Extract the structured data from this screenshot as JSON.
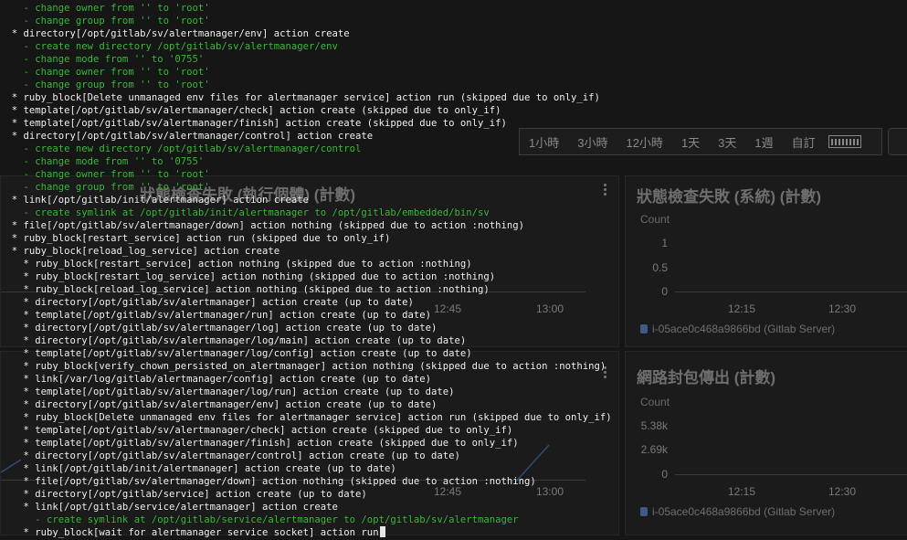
{
  "dashboard": {
    "time_range": {
      "options": [
        "1小時",
        "3小時",
        "12小時",
        "1天",
        "3天",
        "1週",
        "自訂"
      ]
    },
    "panels": [
      {
        "title": "狀態檢查失敗 (執行個體) (計數)",
        "x_ticks": [
          "12:45",
          "13:00"
        ]
      },
      {
        "title": "狀態檢查失敗 (系統) (計數)",
        "unit": "Count",
        "y_ticks": [
          "1",
          "0.5",
          "0"
        ],
        "x_ticks": [
          "12:15",
          "12:30"
        ],
        "legend": "i-05ace0c468a9866bd (Gitlab Server)",
        "legend_color": "#3d5a86"
      },
      {
        "title": "",
        "x_ticks": [
          "12:45",
          "13:00"
        ]
      },
      {
        "title": "網路封包傳出 (計數)",
        "unit": "Count",
        "y_ticks": [
          "5.38k",
          "2.69k",
          "0"
        ],
        "x_ticks": [
          "12:15",
          "12:30"
        ],
        "legend": "i-05ace0c468a9866bd (Gitlab Server)",
        "legend_color": "#3d5a86"
      }
    ]
  },
  "terminal": {
    "colors": {
      "white": "#f4f4f4",
      "green": "#3bbf3b"
    },
    "lines": [
      {
        "c": "green",
        "t": "    - change owner from '' to 'root'"
      },
      {
        "c": "green",
        "t": "    - change group from '' to 'root'"
      },
      {
        "c": "white",
        "t": "  * directory[/opt/gitlab/sv/alertmanager/env] action create"
      },
      {
        "c": "green",
        "t": "    - create new directory /opt/gitlab/sv/alertmanager/env"
      },
      {
        "c": "green",
        "t": "    - change mode from '' to '0755'"
      },
      {
        "c": "green",
        "t": "    - change owner from '' to 'root'"
      },
      {
        "c": "green",
        "t": "    - change group from '' to 'root'"
      },
      {
        "c": "white",
        "t": "  * ruby_block[Delete unmanaged env files for alertmanager service] action run (skipped due to only_if)"
      },
      {
        "c": "white",
        "t": "  * template[/opt/gitlab/sv/alertmanager/check] action create (skipped due to only_if)"
      },
      {
        "c": "white",
        "t": "  * template[/opt/gitlab/sv/alertmanager/finish] action create (skipped due to only_if)"
      },
      {
        "c": "white",
        "t": "  * directory[/opt/gitlab/sv/alertmanager/control] action create"
      },
      {
        "c": "green",
        "t": "    - create new directory /opt/gitlab/sv/alertmanager/control"
      },
      {
        "c": "green",
        "t": "    - change mode from '' to '0755'"
      },
      {
        "c": "green",
        "t": "    - change owner from '' to 'root'"
      },
      {
        "c": "green",
        "t": "    - change group from '' to 'root'"
      },
      {
        "c": "white",
        "t": "  * link[/opt/gitlab/init/alertmanager] action create"
      },
      {
        "c": "green",
        "t": "    - create symlink at /opt/gitlab/init/alertmanager to /opt/gitlab/embedded/bin/sv"
      },
      {
        "c": "white",
        "t": "  * file[/opt/gitlab/sv/alertmanager/down] action nothing (skipped due to action :nothing)"
      },
      {
        "c": "white",
        "t": "  * ruby_block[restart_service] action run (skipped due to only_if)"
      },
      {
        "c": "white",
        "t": "  * ruby_block[reload_log_service] action create"
      },
      {
        "c": "white",
        "t": "    * ruby_block[restart_service] action nothing (skipped due to action :nothing)"
      },
      {
        "c": "white",
        "t": "    * ruby_block[restart_log_service] action nothing (skipped due to action :nothing)"
      },
      {
        "c": "white",
        "t": "    * ruby_block[reload_log_service] action nothing (skipped due to action :nothing)"
      },
      {
        "c": "white",
        "t": "    * directory[/opt/gitlab/sv/alertmanager] action create (up to date)"
      },
      {
        "c": "white",
        "t": "    * template[/opt/gitlab/sv/alertmanager/run] action create (up to date)"
      },
      {
        "c": "white",
        "t": "    * directory[/opt/gitlab/sv/alertmanager/log] action create (up to date)"
      },
      {
        "c": "white",
        "t": "    * directory[/opt/gitlab/sv/alertmanager/log/main] action create (up to date)"
      },
      {
        "c": "white",
        "t": "    * template[/opt/gitlab/sv/alertmanager/log/config] action create (up to date)"
      },
      {
        "c": "white",
        "t": "    * ruby_block[verify_chown_persisted_on_alertmanager] action nothing (skipped due to action :nothing)"
      },
      {
        "c": "white",
        "t": "    * link[/var/log/gitlab/alertmanager/config] action create (up to date)"
      },
      {
        "c": "white",
        "t": "    * template[/opt/gitlab/sv/alertmanager/log/run] action create (up to date)"
      },
      {
        "c": "white",
        "t": "    * directory[/opt/gitlab/sv/alertmanager/env] action create (up to date)"
      },
      {
        "c": "white",
        "t": "    * ruby_block[Delete unmanaged env files for alertmanager service] action run (skipped due to only_if)"
      },
      {
        "c": "white",
        "t": "    * template[/opt/gitlab/sv/alertmanager/check] action create (skipped due to only_if)"
      },
      {
        "c": "white",
        "t": "    * template[/opt/gitlab/sv/alertmanager/finish] action create (skipped due to only_if)"
      },
      {
        "c": "white",
        "t": "    * directory[/opt/gitlab/sv/alertmanager/control] action create (up to date)"
      },
      {
        "c": "white",
        "t": "    * link[/opt/gitlab/init/alertmanager] action create (up to date)"
      },
      {
        "c": "white",
        "t": "    * file[/opt/gitlab/sv/alertmanager/down] action nothing (skipped due to action :nothing)"
      },
      {
        "c": "white",
        "t": "    * directory[/opt/gitlab/service] action create (up to date)"
      },
      {
        "c": "white",
        "t": "    * link[/opt/gitlab/service/alertmanager] action create"
      },
      {
        "c": "green",
        "t": "      - create symlink at /opt/gitlab/service/alertmanager to /opt/gitlab/sv/alertmanager"
      },
      {
        "c": "white",
        "t": "    * ruby_block[wait for alertmanager service socket] action run"
      }
    ]
  }
}
